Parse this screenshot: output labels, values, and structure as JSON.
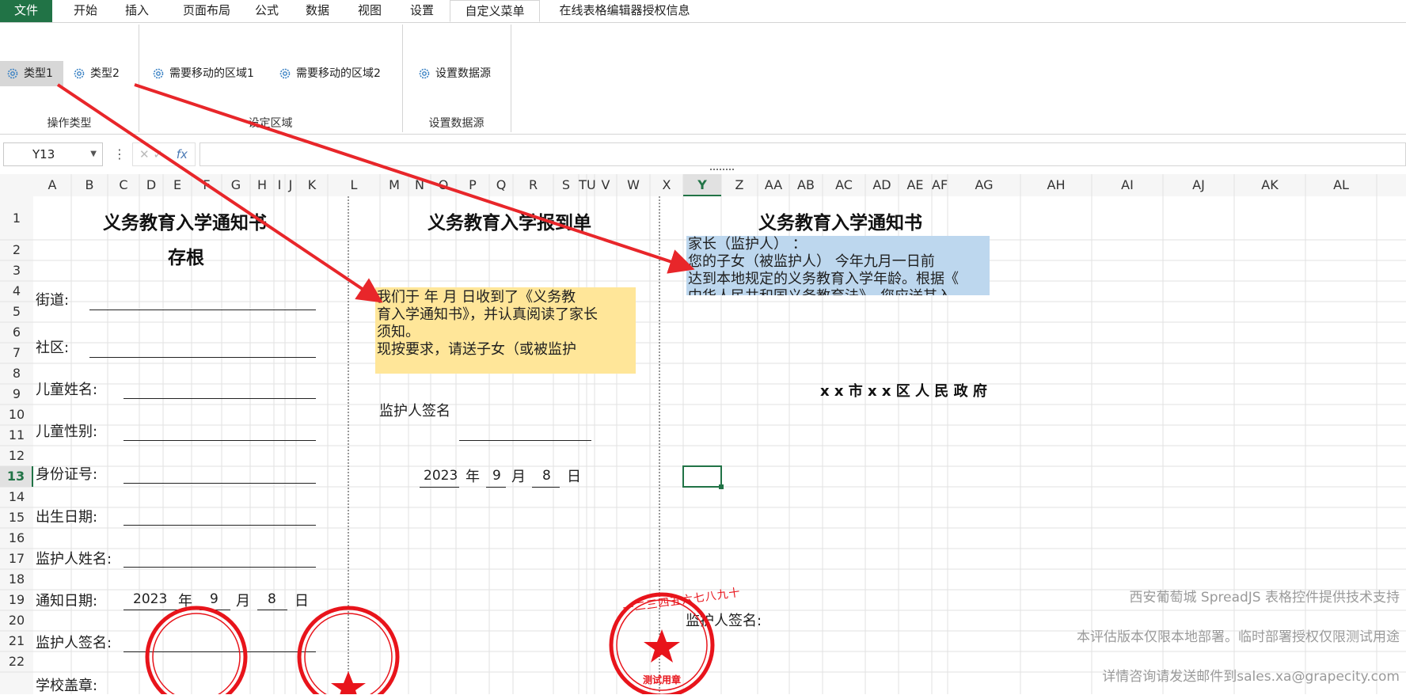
{
  "ribbon_tabs": [
    "文件",
    "开始",
    "插入",
    "页面布局",
    "公式",
    "数据",
    "视图",
    "设置",
    "自定义菜单",
    "在线表格编辑器授权信息"
  ],
  "ribbon": {
    "type1": "类型1",
    "type2": "类型2",
    "area1": "需要移动的区域1",
    "area2": "需要移动的区域2",
    "set_ds": "设置数据源",
    "group_op": "操作类型",
    "group_area": "设定区域",
    "group_ds": "设置数据源"
  },
  "formula_bar": {
    "cell_ref": "Y13",
    "fx_label": "fx",
    "cancel_icon": "✕",
    "confirm_icon": "✓",
    "formula": ""
  },
  "columns": [
    "A",
    "B",
    "C",
    "D",
    "E",
    "F",
    "G",
    "H",
    "I",
    "J",
    "K",
    "L",
    "M",
    "N",
    "O",
    "P",
    "Q",
    "R",
    "S",
    "T",
    "U",
    "V",
    "W",
    "X",
    "Y",
    "Z",
    "AA",
    "AB",
    "AC",
    "AD",
    "AE",
    "AF",
    "AG",
    "AH",
    "AI",
    "AJ",
    "AK",
    "AL"
  ],
  "rows": [
    "1",
    "2",
    "3",
    "4",
    "5",
    "6",
    "7",
    "8",
    "9",
    "10",
    "11",
    "12",
    "13",
    "14",
    "15",
    "16",
    "17",
    "18",
    "19",
    "20",
    "21",
    "22"
  ],
  "selected": {
    "column": "Y",
    "row": "13"
  },
  "sheet": {
    "stub_title_1": "义务教育入学通知书",
    "stub_title_2": "存根",
    "street": "街道:",
    "community": "社区:",
    "child_name": "儿童姓名:",
    "child_gender": "儿童性别:",
    "id_number": "身份证号:",
    "birth_date": "出生日期:",
    "guardian_name": "监护人姓名:",
    "notice_date": "通知日期:",
    "guardian_sign": "监护人签名:",
    "school_seal": "学校盖章:",
    "date_year": "2023",
    "date_month": "9",
    "date_day": "8",
    "unit_year": "年",
    "unit_month": "月",
    "unit_day": "日",
    "report_title": "义务教育入学报到单",
    "report_text_1": "  我们于    年  月  日收到了《义务教",
    "report_text_2": "育入学通知书》，并认真阅读了家长",
    "report_text_3": "须知。",
    "report_text_4": "   现按要求，请送子女（或被监护",
    "report_guardian_sign": "监护人签名",
    "notice_title": "义务教育入学通知书",
    "notice_text_1": "  家长（监护人）     ：",
    "notice_text_2": "   您的子女（被监护人）     今年九月一日前",
    "notice_text_3": "达到本地规定的义务教育入学年龄。根据《",
    "notice_text_4": "中华人民共和国义务教育法》，您应送其入",
    "government": "x x 市 x x 区 人 民 政 府",
    "notice_guardian_sign": "监护人签名:"
  },
  "seals": {
    "seal_text": "一二三四五六七八九十",
    "seal_caption": "测试用章"
  },
  "watermark": {
    "line1": "西安葡萄城 SpreadJS 表格控件提供技术支持",
    "line2": "本评估版本仅限本地部署。临时部署授权仅限测试用途",
    "line3": "详情咨询请发送邮件到sales.xa@grapecity.com"
  },
  "colors": {
    "accent_green": "#217346",
    "arrow_red": "#e8262a",
    "yellow_fill": "#ffe699",
    "blue_fill": "#bdd7ee",
    "seal_red": "#e8141b"
  }
}
